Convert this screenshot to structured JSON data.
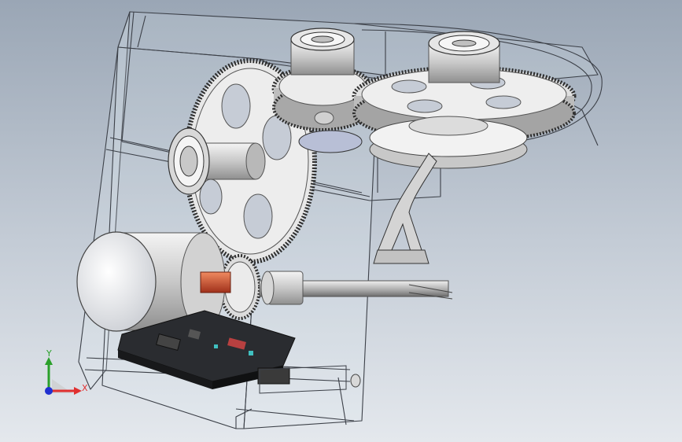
{
  "viewport": {
    "background_top": "#9aa6b5",
    "background_bottom": "#e4e8ed"
  },
  "triad": {
    "x_label": "X",
    "y_label": "Y",
    "x_color": "#e03030",
    "y_color": "#2aa02a",
    "z_color": "#2030d0"
  },
  "model": {
    "housing_color": "#3c4048",
    "gear_color": "#e6e6e6",
    "motor_color": "#f2f2f2",
    "coupling_color": "#d04a2a",
    "board_color": "#2a2c30"
  }
}
